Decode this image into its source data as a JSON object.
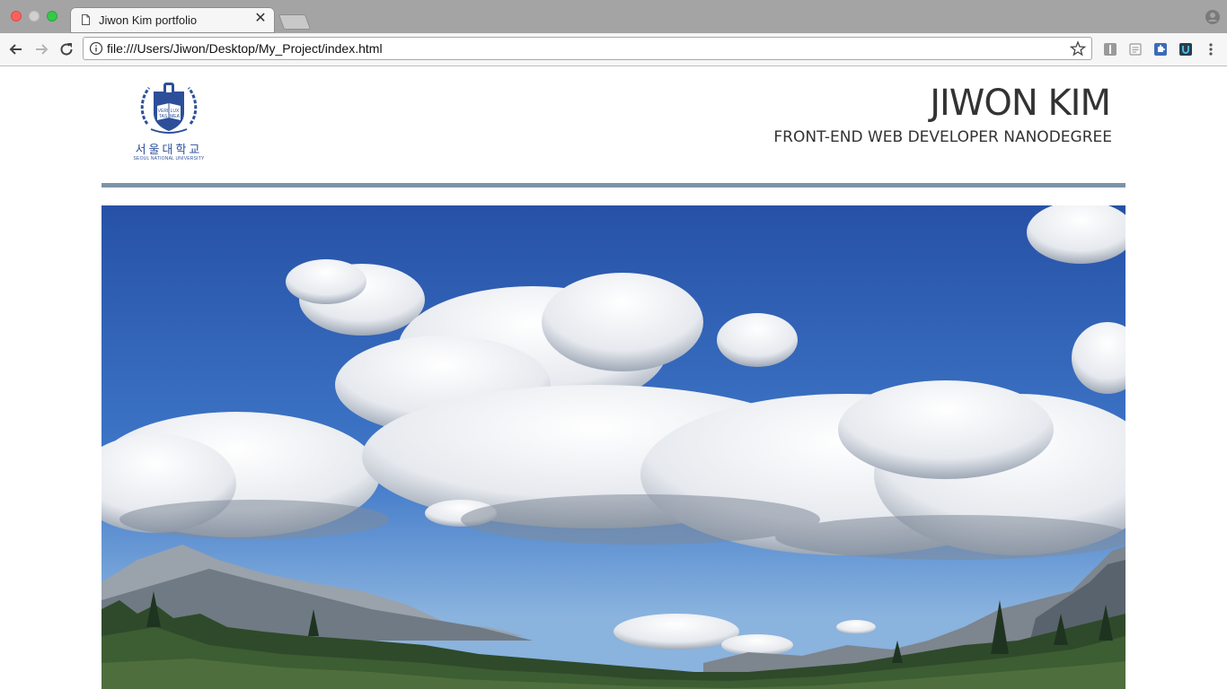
{
  "browser": {
    "tab_title": "Jiwon Kim portfolio",
    "url": "file:///Users/Jiwon/Desktop/My_Project/index.html",
    "icons": [
      "document-icon",
      "close-icon",
      "profile-icon",
      "back-icon",
      "forward-icon",
      "reload-icon",
      "info-icon",
      "star-icon",
      "extension-icon",
      "menu-icon"
    ]
  },
  "logo": {
    "korean_name": "서울대학교",
    "english_name": "SEOUL NATIONAL UNIVERSITY",
    "emblem_text": "VERI TAS LUX MEA"
  },
  "header": {
    "title": "JIWON KIM",
    "subtitle": "FRONT-END WEB DEVELOPER NANODEGREE"
  },
  "colors": {
    "divider": "#7d93a6",
    "logo_blue": "#2d4f9a",
    "sky": "#2f5fb3"
  }
}
